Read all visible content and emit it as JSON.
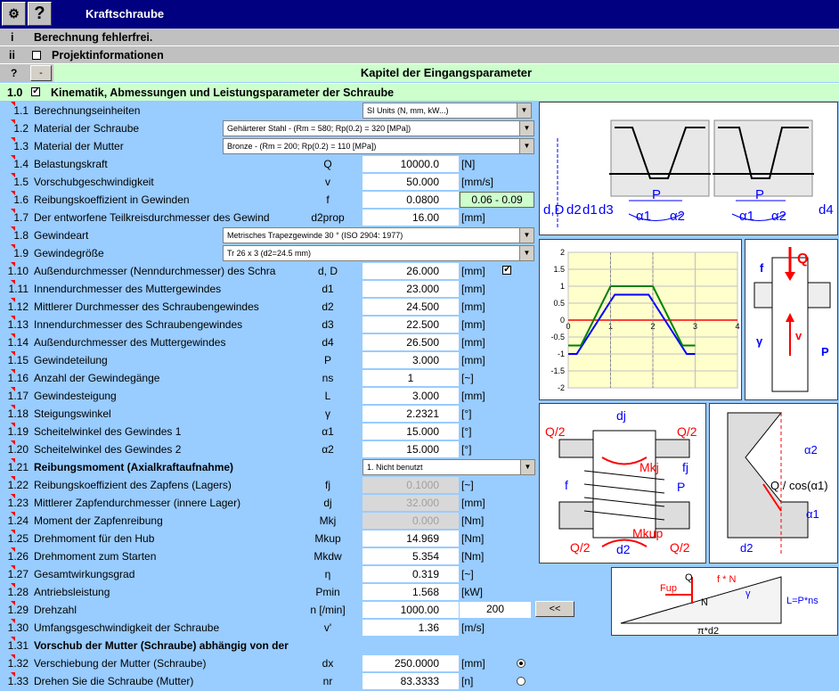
{
  "window": {
    "title": "Kraftschraube",
    "help_label": "?"
  },
  "status_bar": {
    "num": "i",
    "text": "Berechnung fehlerfrei."
  },
  "project_bar": {
    "num": "ii",
    "text": "Projektinformationen"
  },
  "chapter_bar": {
    "q": "?",
    "minus": "-",
    "text": "Kapitel der Eingangsparameter"
  },
  "section_bar": {
    "num": "1.0",
    "text": "Kinematik, Abmessungen und Leistungsparameter der Schraube"
  },
  "rows": [
    {
      "num": "1.1",
      "label": "Berechnungseinheiten",
      "dropdown": "SI Units (N, mm, kW...)"
    },
    {
      "num": "1.2",
      "label": "Material der Schraube",
      "dropdown": "Gehärterer Stahl - (Rm = 580;  Rp(0.2) = 320 [MPa])"
    },
    {
      "num": "1.3",
      "label": "Material der Mutter",
      "dropdown": "Bronze - (Rm = 200;  Rp(0.2) = 110 [MPa])"
    },
    {
      "num": "1.4",
      "label": "Belastungskraft",
      "sym": "Q",
      "value": "10000.0",
      "unit": "[N]"
    },
    {
      "num": "1.5",
      "label": "Vorschubgeschwindigkeit",
      "sym": "v",
      "value": "50.000",
      "unit": "[mm/s]"
    },
    {
      "num": "1.6",
      "label": "Reibungskoeffizient in Gewinden",
      "sym": "f",
      "value": "0.0800",
      "range": "0.06 - 0.09"
    },
    {
      "num": "1.7",
      "label": "Der entworfene Teilkreisdurchmesser des Gewind",
      "sym": "d2prop",
      "value": "16.00",
      "unit": "[mm]"
    },
    {
      "num": "1.8",
      "label": "Gewindeart",
      "dropdown": "Metrisches Trapezgewinde 30 °   (ISO 2904: 1977)"
    },
    {
      "num": "1.9",
      "label": "Gewindegröße",
      "dropdown": "Tr 26 x 3  (d2=24.5 mm)"
    },
    {
      "num": "1.10",
      "label": "Außendurchmesser (Nenndurchmesser) des Schra",
      "sym": "d, D",
      "value": "26.000",
      "unit": "[mm]"
    },
    {
      "num": "1.11",
      "label": "Innendurchmesser des Muttergewindes",
      "sym": "d1",
      "value": "23.000",
      "unit": "[mm]"
    },
    {
      "num": "1.12",
      "label": "Mittlerer Durchmesser des Schraubengewindes",
      "sym": "d2",
      "value": "24.500",
      "unit": "[mm]"
    },
    {
      "num": "1.13",
      "label": "Innendurchmesser des Schraubengewindes",
      "sym": "d3",
      "value": "22.500",
      "unit": "[mm]"
    },
    {
      "num": "1.14",
      "label": "Außendurchmesser des Muttergewindes",
      "sym": "d4",
      "value": "26.500",
      "unit": "[mm]"
    },
    {
      "num": "1.15",
      "label": "Gewindeteilung",
      "sym": "P",
      "value": "3.000",
      "unit": "[mm]"
    },
    {
      "num": "1.16",
      "label": "Anzahl der Gewindegänge",
      "sym": "ns",
      "value": "1",
      "unit": "[~]"
    },
    {
      "num": "1.17",
      "label": "Gewindesteigung",
      "sym": "L",
      "value": "3.000",
      "unit": "[mm]"
    },
    {
      "num": "1.18",
      "label": "Steigungswinkel",
      "sym": "γ",
      "value": "2.2321",
      "unit": "[°]"
    },
    {
      "num": "1.19",
      "label": "Scheitelwinkel des Gewindes 1",
      "sym": "α1",
      "value": "15.000",
      "unit": "[°]"
    },
    {
      "num": "1.20",
      "label": "Scheitelwinkel des Gewindes 2",
      "sym": "α2",
      "value": "15.000",
      "unit": "[°]"
    },
    {
      "num": "1.21",
      "label": "Reibungsmoment (Axialkraftaufnahme)",
      "dropdown": "1.  Nicht benutzt"
    },
    {
      "num": "1.22",
      "label": "Reibungskoeffizient des Zapfens (Lagers)",
      "sym": "fj",
      "value": "0.1000",
      "unit": "[~]"
    },
    {
      "num": "1.23",
      "label": "Mittlerer Zapfendurchmesser (innere Lager)",
      "sym": "dj",
      "value": "32.000",
      "unit": "[mm]"
    },
    {
      "num": "1.24",
      "label": "Moment der Zapfenreibung",
      "sym": "Mkj",
      "value": "0.000",
      "unit": "[Nm]"
    },
    {
      "num": "1.25",
      "label": "Drehmoment für den Hub",
      "sym": "Mkup",
      "value": "14.969",
      "unit": "[Nm]"
    },
    {
      "num": "1.26",
      "label": "Drehmoment zum Starten",
      "sym": "Mkdw",
      "value": "5.354",
      "unit": "[Nm]"
    },
    {
      "num": "1.27",
      "label": "Gesamtwirkungsgrad",
      "sym": "η",
      "value": "0.319",
      "unit": "[~]"
    },
    {
      "num": "1.28",
      "label": "Antriebsleistung",
      "sym": "Pmin",
      "value": "1.568",
      "unit": "[kW]"
    },
    {
      "num": "1.29",
      "label": "Drehzahl",
      "sym": "n [/min]",
      "value": "1000.00",
      "extra": "200",
      "button": "<<"
    },
    {
      "num": "1.30",
      "label": "Umfangsgeschwindigkeit der Schraube",
      "sym": "v'",
      "value": "1.36",
      "unit": "[m/s]"
    },
    {
      "num": "1.31",
      "label": "Vorschub der Mutter (Schraube) abhängig von der Drehzahl"
    },
    {
      "num": "1.32",
      "label": "Verschiebung der Mutter (Schraube)",
      "sym": "dx",
      "value": "250.0000",
      "unit": "[mm]"
    },
    {
      "num": "1.33",
      "label": "Drehen Sie die Schraube (Mutter)",
      "sym": "nr",
      "value": "83.3333",
      "unit": "[n]"
    }
  ],
  "diagram_labels": {
    "thread": [
      "d,D",
      "d2",
      "d1",
      "d3",
      "P",
      "α1",
      "α2",
      "P",
      "α1",
      "α2",
      "d4"
    ],
    "force": [
      "Q",
      "f",
      "v",
      "γ",
      "P"
    ],
    "collar": [
      "dj",
      "Q/2",
      "Q/2",
      "Mkj",
      "fj",
      "P",
      "f",
      "Q/2",
      "d2",
      "Mkup",
      "Q/2"
    ],
    "angle": [
      "α2",
      "Q / cos(α1)",
      "α1",
      "d2"
    ],
    "incline": [
      "Q",
      "f * N",
      "Fup",
      "N",
      "γ",
      "L=P*ns",
      "π*d2"
    ]
  },
  "chart_data": {
    "type": "line",
    "xlim": [
      0,
      4
    ],
    "ylim": [
      -2,
      2
    ],
    "xticks": [
      "0",
      "1",
      "2",
      "3",
      "4"
    ],
    "yticks": [
      "2",
      "1.5",
      "1",
      "0.5",
      "0",
      "-0.5",
      "-1",
      "-1.5",
      "-2"
    ],
    "series": [
      {
        "color": "#0000ff",
        "x": [
          0,
          0.2,
          1.1,
          1.9,
          2.8,
          3.0
        ],
        "y": [
          -1,
          -1,
          0.75,
          0.75,
          -1,
          -1
        ]
      },
      {
        "color": "#008000",
        "x": [
          0,
          0.3,
          1.0,
          2.0,
          2.7,
          3.0
        ],
        "y": [
          -0.75,
          -0.75,
          1,
          1,
          -0.75,
          -0.75
        ]
      }
    ]
  }
}
